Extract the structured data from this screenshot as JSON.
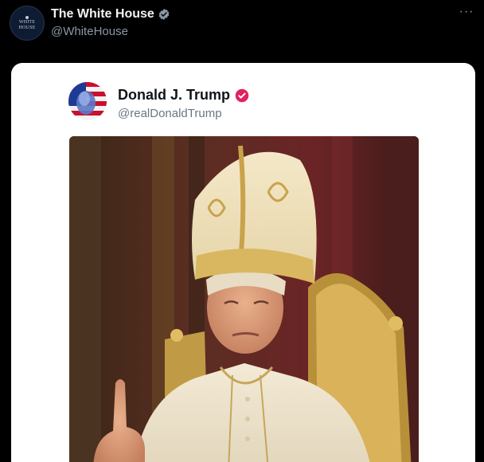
{
  "tweet": {
    "display_name": "The White House",
    "handle": "@WhiteHouse",
    "avatar_text": [
      "WHITE",
      "HOUSE"
    ],
    "more_icon": "more-icon"
  },
  "embedded_post": {
    "display_name": "Donald J. Trump",
    "handle": "@realDonaldTrump",
    "verified_color": "#e0245e",
    "image_description_icon": "portrait-image"
  },
  "colors": {
    "background": "#000000",
    "card": "#ffffff",
    "verified_blue": "#8b98a5"
  }
}
